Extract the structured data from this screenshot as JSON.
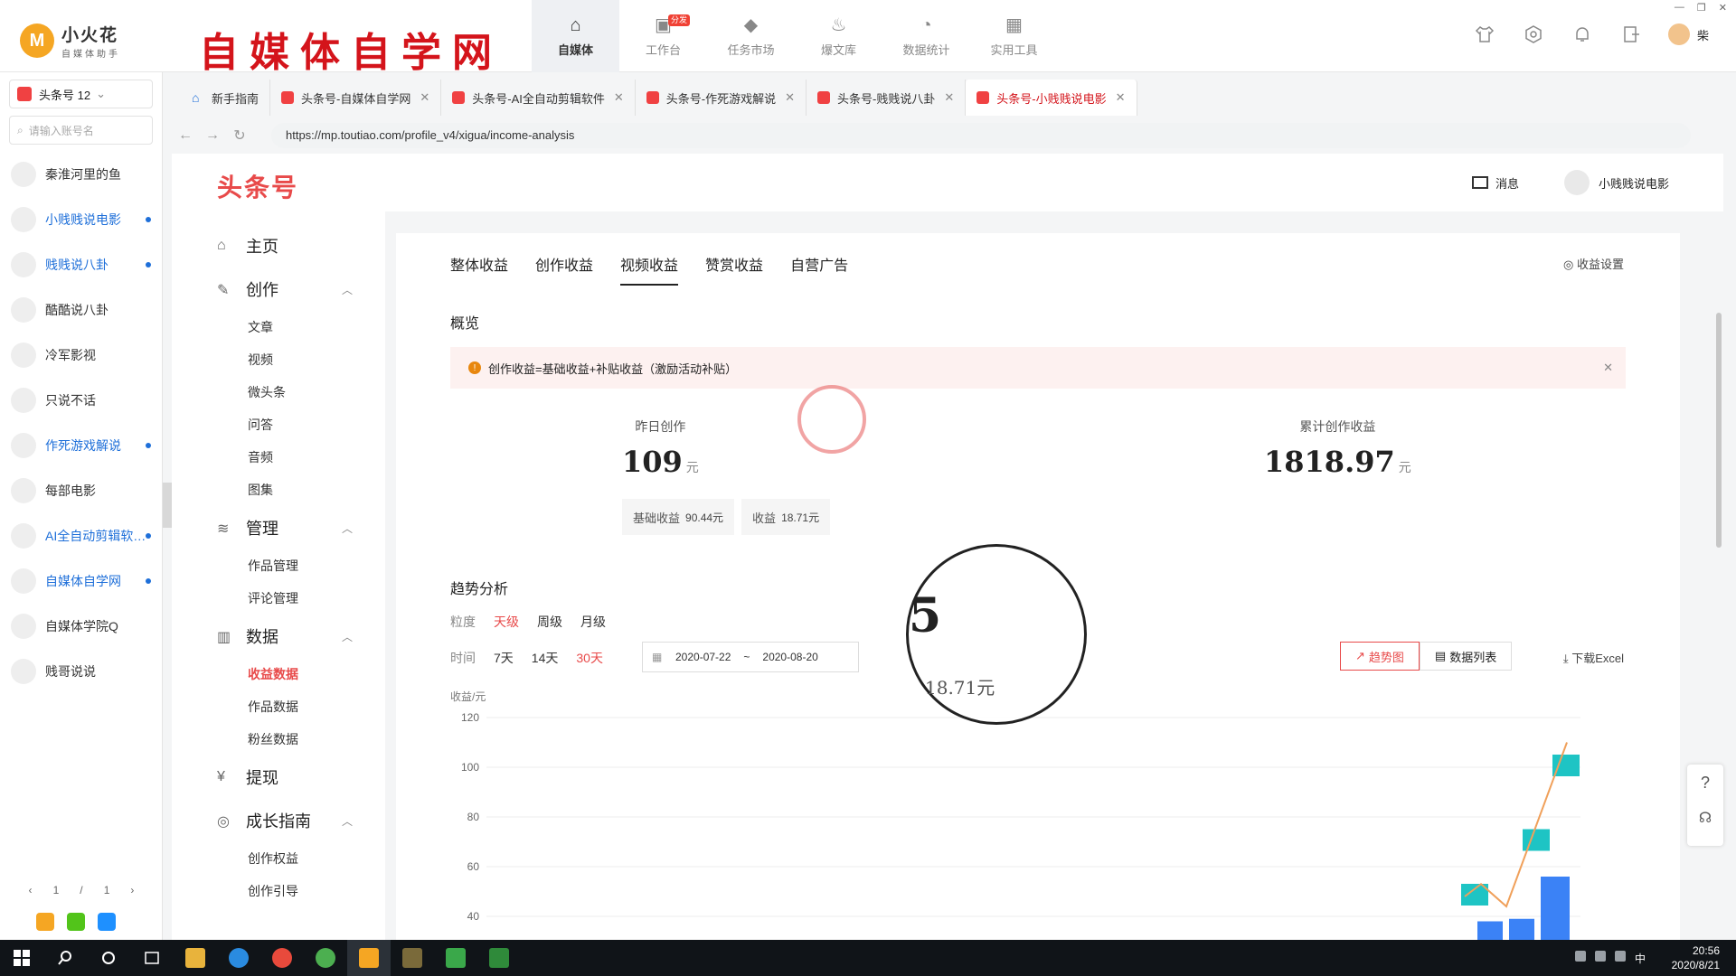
{
  "app": {
    "name": "小火花",
    "subtitle": "自媒体助手",
    "badge_letter": "M",
    "brand_title": "自媒体自学网",
    "nav": [
      {
        "label": "自媒体",
        "icon": "home-icon",
        "active": true
      },
      {
        "label": "工作台",
        "icon": "workbench-icon",
        "tag": "分发"
      },
      {
        "label": "任务市场",
        "icon": "cube-icon"
      },
      {
        "label": "爆文库",
        "icon": "fire-icon"
      },
      {
        "label": "数据统计",
        "icon": "pie-chart-icon"
      },
      {
        "label": "实用工具",
        "icon": "apps-icon"
      }
    ],
    "user_name": "柴"
  },
  "accounts": {
    "selector_label": "头条号 12",
    "search_placeholder": "请输入账号名",
    "items": [
      {
        "name": "秦淮河里的鱼",
        "highlight": false
      },
      {
        "name": "小贱贱说电影",
        "highlight": true
      },
      {
        "name": "贱贱说八卦",
        "highlight": true
      },
      {
        "name": "酷酷说八卦",
        "highlight": false
      },
      {
        "name": "冷军影视",
        "highlight": false
      },
      {
        "name": "只说不话",
        "highlight": false
      },
      {
        "name": "作死游戏解说",
        "highlight": true
      },
      {
        "name": "每部电影",
        "highlight": false
      },
      {
        "name": "AI全自动剪辑软…",
        "highlight": true
      },
      {
        "name": "自媒体自学网",
        "highlight": true
      },
      {
        "name": "自媒体学院Q",
        "highlight": false
      },
      {
        "name": "贱哥说说",
        "highlight": false
      }
    ],
    "pager": {
      "prev": "‹",
      "current": "1",
      "sep": "/",
      "total": "1",
      "next": "›"
    }
  },
  "browser": {
    "tabs": [
      {
        "label": "新手指南",
        "closable": false,
        "home": true
      },
      {
        "label": "头条号-自媒体自学网",
        "closable": true
      },
      {
        "label": "头条号-AI全自动剪辑软件",
        "closable": true
      },
      {
        "label": "头条号-作死游戏解说",
        "closable": true
      },
      {
        "label": "头条号-贱贱说八卦",
        "closable": true
      },
      {
        "label": "头条号-小贱贱说电影",
        "closable": true,
        "active": true
      }
    ],
    "url": "https://mp.toutiao.com/profile_v4/xigua/income-analysis"
  },
  "page": {
    "logo": "头条号",
    "messages": "消息",
    "account": "小贱贱说电影",
    "menu": [
      {
        "label": "主页",
        "icon": "home-icon",
        "children": []
      },
      {
        "label": "创作",
        "icon": "pen-icon",
        "children": [
          "文章",
          "视频",
          "微头条",
          "问答",
          "音频",
          "图集"
        ]
      },
      {
        "label": "管理",
        "icon": "layers-icon",
        "children": [
          "作品管理",
          "评论管理"
        ]
      },
      {
        "label": "数据",
        "icon": "bar-chart-icon",
        "children": [
          "收益数据",
          "作品数据",
          "粉丝数据"
        ]
      },
      {
        "label": "提现",
        "icon": "yen-icon",
        "children": []
      },
      {
        "label": "成长指南",
        "icon": "growth-icon",
        "children": [
          "创作权益",
          "创作引导"
        ]
      }
    ],
    "active_submenu": "收益数据",
    "tabs": [
      "整体收益",
      "创作收益",
      "视频收益",
      "赞赏收益",
      "自营广告"
    ],
    "active_tab": "视频收益",
    "income_settings": "收益设置",
    "overview_title": "概览",
    "notice": "创作收益=基础收益+补贴收益（激励活动补贴）",
    "stats": {
      "yesterday_label": "昨日创作",
      "yesterday_value": "109",
      "unit": "元",
      "total_label": "累计创作收益",
      "total_value": "1818.97",
      "basic_label": "基础收益",
      "basic_value": "90.44元",
      "subsidy_label": "收益",
      "subsidy_value": "18.71元",
      "magnified_digit": "5"
    },
    "trend": {
      "title": "趋势分析",
      "granularity_label": "粒度",
      "granularity": [
        "天级",
        "周级",
        "月级"
      ],
      "active_granularity": "天级",
      "time_label": "时间",
      "ranges": [
        "7天",
        "14天",
        "30天"
      ],
      "active_range": "30天",
      "date_from": "2020-07-22",
      "date_to": "2020-08-20",
      "date_sep": "~",
      "view_chart": "趋势图",
      "view_table": "数据列表",
      "download": "下载Excel",
      "y_unit": "收益/元"
    }
  },
  "chart_data": {
    "type": "bar",
    "ylabel": "收益/元",
    "ylim": [
      40,
      120
    ],
    "yticks": [
      40,
      60,
      80,
      100,
      120
    ],
    "series": [
      {
        "values": [
          48,
          38,
          39,
          56
        ],
        "color": "#3b82f6"
      },
      {
        "values": [
          48,
          70,
          100
        ],
        "color": "#1ec4c4"
      },
      {
        "values": [
          48,
          53,
          44,
          110
        ],
        "color": "#f0a05a"
      }
    ],
    "grid": true
  },
  "taskbar": {
    "time": "20:56",
    "date": "2020/8/21",
    "ime": "中"
  }
}
